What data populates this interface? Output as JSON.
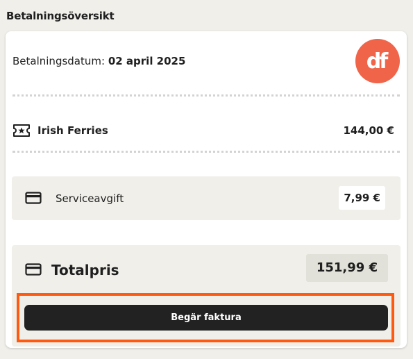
{
  "header": {
    "title": "Betalningsöversikt"
  },
  "payment": {
    "date_label": "Betalningsdatum:",
    "date_value": "02 april 2025",
    "logo": {
      "text": "df",
      "color": "#f0644a",
      "icon": "df-logo"
    }
  },
  "items": [
    {
      "icon": "ticket-icon",
      "name": "Irish Ferries",
      "price": "144,00 €"
    }
  ],
  "service_fee": {
    "icon": "credit-card-icon",
    "label": "Serviceavgift",
    "amount": "7,99 €"
  },
  "total": {
    "icon": "credit-card-icon",
    "label": "Totalpris",
    "amount": "151,99 €"
  },
  "actions": {
    "invoice_button": "Begär faktura"
  },
  "colors": {
    "accent": "#f0644a",
    "highlight": "#ff5a0f",
    "button_bg": "#222222",
    "panel_bg": "#f0efea"
  }
}
